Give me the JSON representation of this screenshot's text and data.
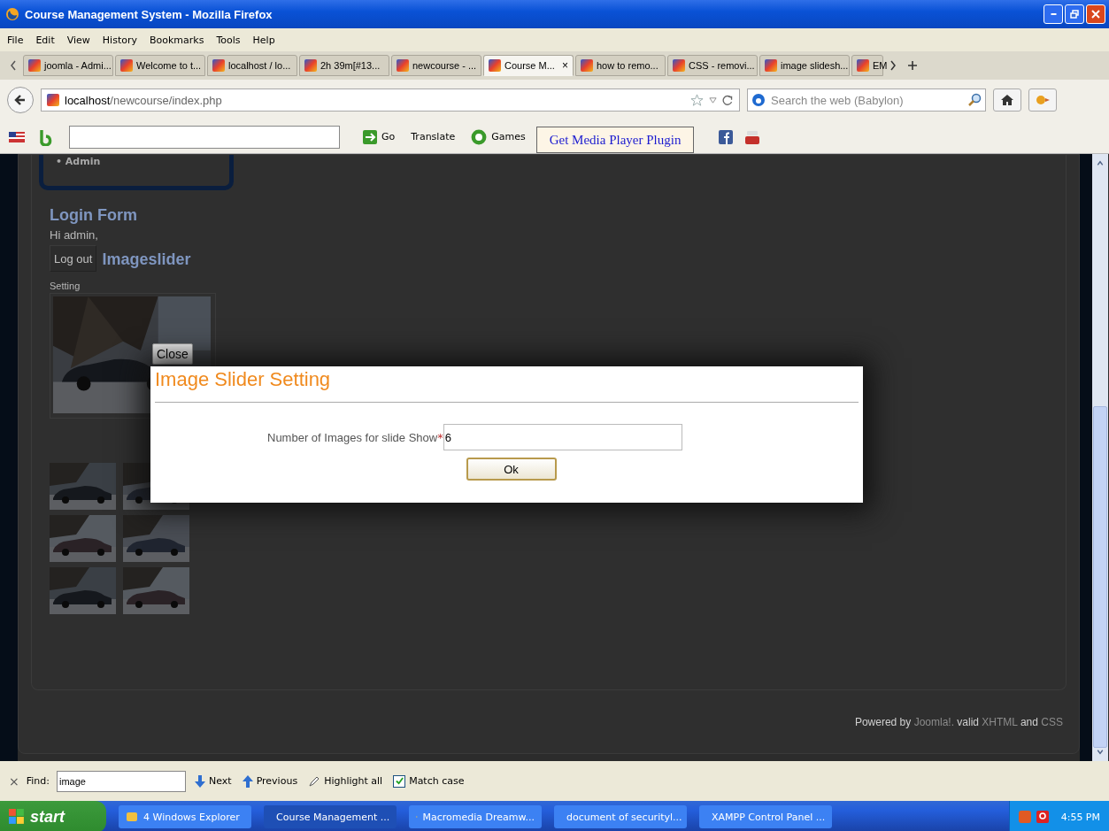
{
  "window": {
    "title": "Course Management System - Mozilla Firefox"
  },
  "menu": [
    "File",
    "Edit",
    "View",
    "History",
    "Bookmarks",
    "Tools",
    "Help"
  ],
  "tabs": [
    {
      "label": "joomla - Admi...",
      "selected": false
    },
    {
      "label": "Welcome to t...",
      "selected": false
    },
    {
      "label": "localhost / lo...",
      "selected": false
    },
    {
      "label": "2h 39m[#13...",
      "selected": false
    },
    {
      "label": "newcourse - ...",
      "selected": false
    },
    {
      "label": "Course M...",
      "selected": true
    },
    {
      "label": "how to remo...",
      "selected": false
    },
    {
      "label": "CSS - removi...",
      "selected": false
    },
    {
      "label": "image slidesh...",
      "selected": false
    },
    {
      "label": "EM",
      "selected": false
    }
  ],
  "tab_close": "×",
  "address": {
    "host": "localhost",
    "path": "/newcourse/index.php"
  },
  "web_search": {
    "placeholder": "Search the web (Babylon)"
  },
  "toolbar": {
    "go": "Go",
    "translate": "Translate",
    "games": "Games",
    "plugin_button": "Get Media Player Plugin"
  },
  "page": {
    "menu_item": "• Admin",
    "login_title": "Login Form",
    "greeting": "Hi admin,",
    "logout": "Log out",
    "slider_title": "Imageslider",
    "setting_link": "Setting",
    "footer": [
      {
        "text": "Powered by",
        "link": false
      },
      {
        "text": "Joomla!.",
        "link": true
      },
      {
        "text": "valid",
        "link": false
      },
      {
        "text": "XHTML",
        "link": true
      },
      {
        "text": "and",
        "link": false
      },
      {
        "text": "CSS",
        "link": true
      }
    ]
  },
  "dialog": {
    "close": "Close",
    "title": "Image Slider Setting",
    "label": "Number of Images for slide Show",
    "required_mark": "*",
    "value": "6",
    "ok": "Ok"
  },
  "find_bar": {
    "close": "×",
    "label": "Find:",
    "value": "image",
    "next": "Next",
    "previous": "Previous",
    "highlight_all": "Highlight all",
    "match_case": {
      "label": "Match case",
      "checked": true
    }
  },
  "taskbar": {
    "start": "start",
    "items": [
      {
        "label": "4 Windows Explorer",
        "selected": false
      },
      {
        "label": "Course Management ...",
        "selected": true
      },
      {
        "label": "Macromedia Dreamw...",
        "selected": false
      },
      {
        "label": "document of securityl...",
        "selected": false
      },
      {
        "label": "XAMPP Control Panel ...",
        "selected": false
      }
    ],
    "clock": "4:55 PM"
  }
}
